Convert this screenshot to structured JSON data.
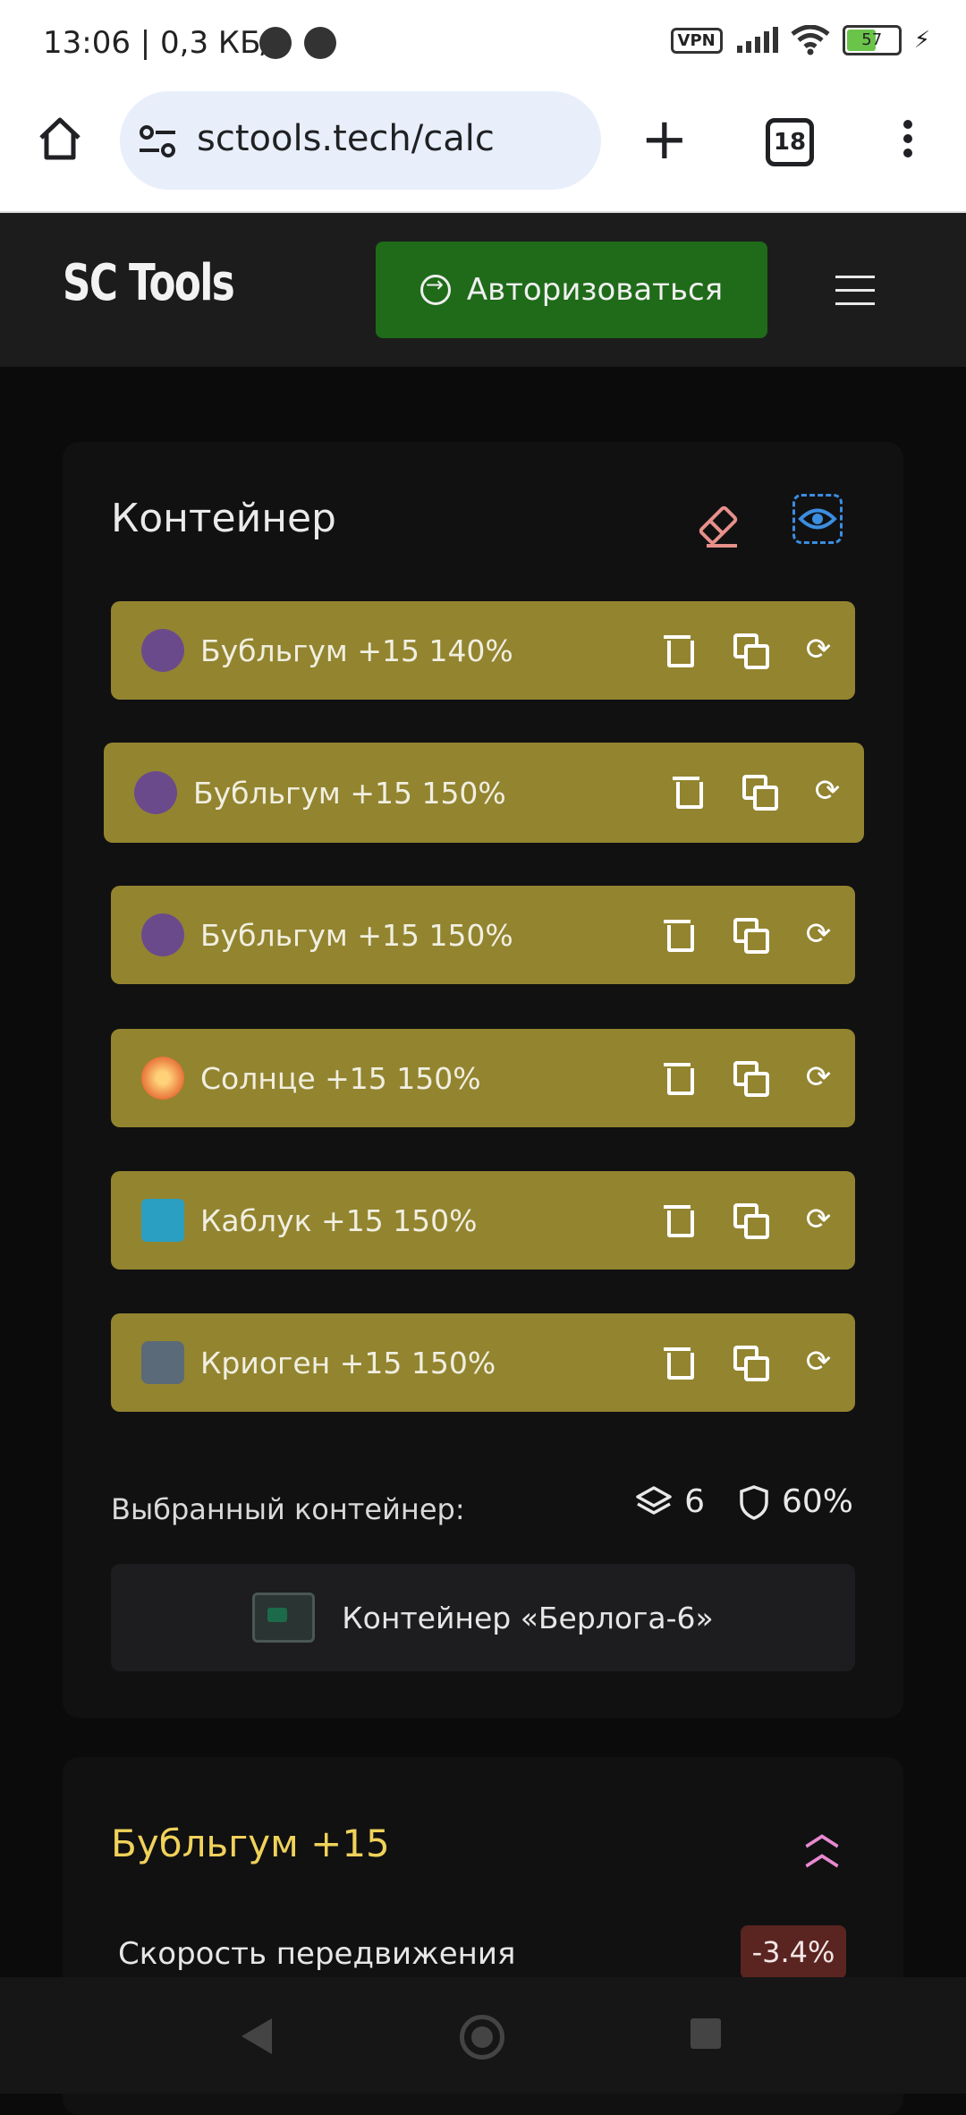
{
  "status_bar": {
    "time": "13:06 | 0,3 КБ/с",
    "vpn": "VPN",
    "battery": "57"
  },
  "browser": {
    "url": "sctools.tech/calc",
    "tab_count": "18"
  },
  "header": {
    "logo": "SC Tools",
    "auth_label": "Авторизоваться"
  },
  "container": {
    "title": "Контейнер",
    "artifacts": [
      {
        "name": "Бубльгум  +15  140%",
        "color": "#6b4a8c"
      },
      {
        "name": "Бубльгум  +15  150%",
        "color": "#6b4a8c"
      },
      {
        "name": "Бубльгум  +15  150%",
        "color": "#6b4a8c"
      },
      {
        "name": "Солнце  +15  150%",
        "color": "#e8743a"
      },
      {
        "name": "Каблук  +15  150%",
        "color": "#2a9fc2"
      },
      {
        "name": "Криоген  +15  150%",
        "color": "#5a6a78"
      }
    ],
    "selected_label": "Выбранный контейнер:",
    "slots": "6",
    "protection": "60%",
    "selected_name": "Контейнер «Берлога-6»"
  },
  "details": {
    "title": "Бубльгум +15",
    "stat_label": "Скорость передвижения",
    "stat_value": "-3.4%"
  }
}
